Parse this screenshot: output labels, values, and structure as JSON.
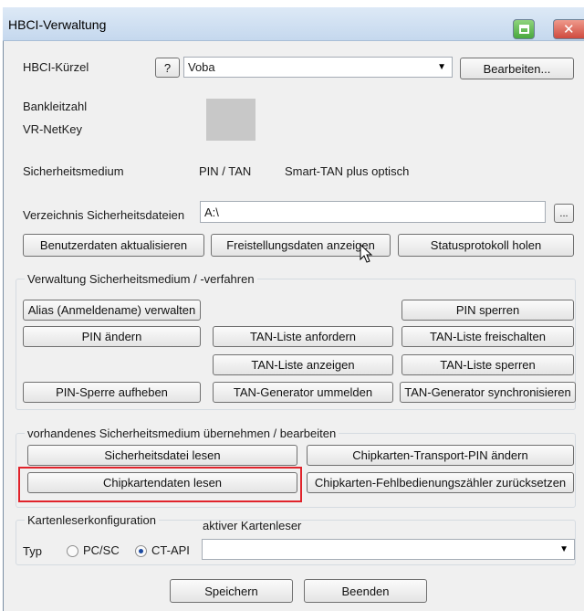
{
  "window": {
    "title": "HBCI-Verwaltung"
  },
  "header": {
    "hbci_kuerzel_label": "HBCI-Kürzel",
    "help_label": "?",
    "hbci_select_value": "Voba",
    "edit_button": "Bearbeiten...",
    "bankleitzahl_label": "Bankleitzahl",
    "vrnetkey_label": "VR-NetKey",
    "sicherheitsmedium_label": "Sicherheitsmedium",
    "sicherheitsmedium_value1": "PIN / TAN",
    "sicherheitsmedium_value2": "Smart-TAN plus optisch",
    "verzeichnis_label": "Verzeichnis Sicherheitsdateien",
    "verzeichnis_value": "A:\\",
    "browse_label": "...",
    "btn_benutzerdaten": "Benutzerdaten aktualisieren",
    "btn_freistellung": "Freistellungsdaten anzeigen",
    "btn_statusprotokoll": "Statusprotokoll holen"
  },
  "verwaltung": {
    "title": "Verwaltung Sicherheitsmedium / -verfahren",
    "alias": "Alias (Anmeldename) verwalten",
    "pin_sperren": "PIN sperren",
    "pin_aendern": "PIN ändern",
    "tan_liste_anfordern": "TAN-Liste anfordern",
    "tan_liste_freischalten": "TAN-Liste freischalten",
    "tan_liste_anzeigen": "TAN-Liste anzeigen",
    "tan_liste_sperren": "TAN-Liste sperren",
    "pin_sperre_aufheben": "PIN-Sperre aufheben",
    "tan_generator_ummelden": "TAN-Generator ummelden",
    "tan_generator_sync": "TAN-Generator synchronisieren"
  },
  "vorhandenes": {
    "title": "vorhandenes Sicherheitsmedium übernehmen / bearbeiten",
    "sicherheitsdatei_lesen": "Sicherheitsdatei lesen",
    "transport_pin": "Chipkarten-Transport-PIN ändern",
    "chipkartendaten_lesen": "Chipkartendaten lesen",
    "fehlbedienung": "Chipkarten-Fehlbedienungszähler zurücksetzen"
  },
  "kartenleser": {
    "title": "Kartenleserkonfiguration",
    "typ_label": "Typ",
    "option_pcsc": "PC/SC",
    "option_ctapi": "CT-API",
    "selected_option": "CT-API",
    "aktiver_label": "aktiver Kartenleser",
    "aktiver_value": ""
  },
  "footer": {
    "save": "Speichern",
    "close": "Beenden"
  },
  "colors": {
    "highlight_border": "#e0232b",
    "title_bar": "#c5d8ee",
    "minimize_button": "#49a93e",
    "close_button": "#cf4a3e"
  }
}
